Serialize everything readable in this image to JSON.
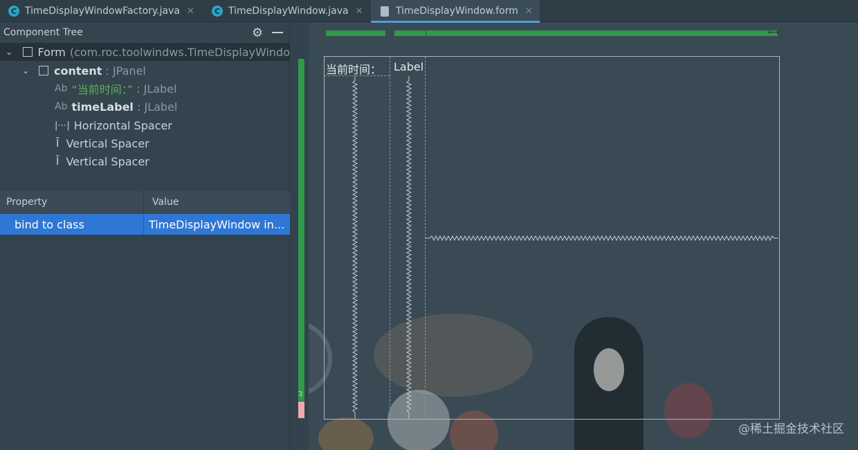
{
  "tabs": [
    {
      "label": "TimeDisplayWindowFactory.java",
      "icon": "java-class-icon",
      "active": false
    },
    {
      "label": "TimeDisplayWindow.java",
      "icon": "java-class-icon",
      "active": false
    },
    {
      "label": "TimeDisplayWindow.form",
      "icon": "form-file-icon",
      "active": true
    }
  ],
  "component_tree": {
    "title": "Component Tree",
    "rows": [
      {
        "name": "Form",
        "detail": "(com.roc.toolwindws.TimeDisplayWindo"
      },
      {
        "name": "content",
        "sep": " : ",
        "type": "JPanel"
      },
      {
        "prefix": "Ab",
        "name": "“当前时间：”",
        "sep": " : ",
        "type": "JLabel"
      },
      {
        "prefix": "Ab",
        "name": "timeLabel",
        "sep": " : ",
        "type": "JLabel"
      },
      {
        "name": "Horizontal Spacer"
      },
      {
        "name": "Vertical Spacer"
      },
      {
        "name": "Vertical Spacer"
      }
    ]
  },
  "properties": {
    "col_property": "Property",
    "col_value": "Value",
    "rows": [
      {
        "property": "bind to class",
        "value": "TimeDisplayWindow in..."
      }
    ]
  },
  "designer": {
    "label1": "当前时间：",
    "label2": "Label",
    "row_number": "3"
  },
  "watermark": "@稀土掘金技术社区",
  "colors": {
    "accent": "#2f77d4",
    "green_bar": "#2f9a48",
    "background": "#34444f"
  }
}
